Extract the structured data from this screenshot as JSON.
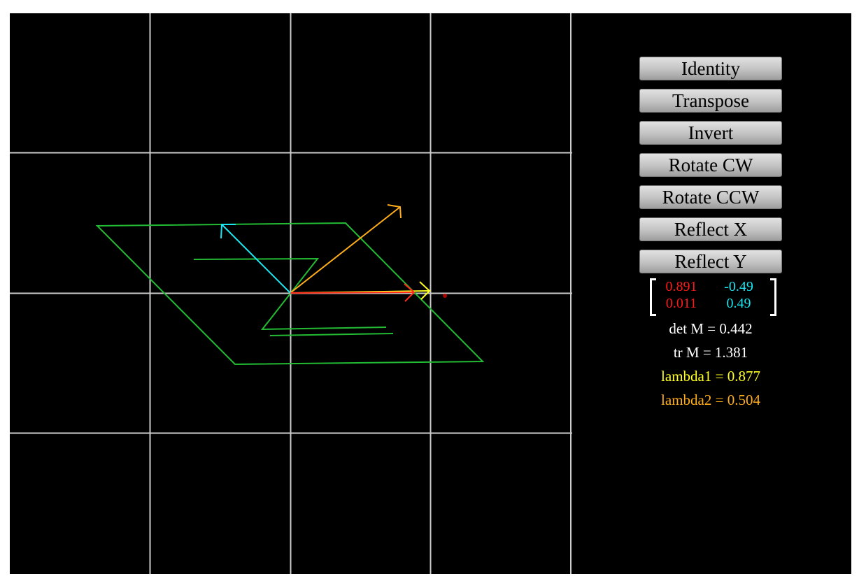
{
  "buttons": {
    "identity": "Identity",
    "transpose": "Transpose",
    "invert": "Invert",
    "rotate_cw": "Rotate CW",
    "rotate_ccw": "Rotate CCW",
    "reflect_x": "Reflect X",
    "reflect_y": "Reflect Y"
  },
  "matrix": {
    "m11": "0.891",
    "m12": "-0.49",
    "m21": "0.011",
    "m22": "0.49"
  },
  "stats": {
    "det": "det M = 0.442",
    "trace": "tr M = 1.381",
    "lambda1": "lambda1 = 0.877",
    "lambda2": "lambda2 = 0.504"
  },
  "colors": {
    "background": "#000000",
    "grid": "#cccccc",
    "shape": "#22bb33",
    "basis_x": "#ff1a1a",
    "basis_y": "#19e6f0",
    "eigen1": "#ffff22",
    "eigen2": "#ffae1a"
  },
  "plot": {
    "grid_spacing": 1,
    "matrix_values": [
      [
        0.891,
        -0.49
      ],
      [
        0.011,
        0.49
      ]
    ],
    "shape_outline": [
      [
        -2,
        0.5
      ],
      [
        -1,
        -0.5
      ],
      [
        2,
        -0.5
      ],
      [
        1,
        0.5
      ]
    ],
    "letter_z_lines": [
      [
        [
          -1.3,
          0.25
        ],
        [
          0.2,
          0.25
        ]
      ],
      [
        [
          0.2,
          0.25
        ],
        [
          -0.2,
          -0.25
        ]
      ],
      [
        [
          -0.2,
          -0.25
        ],
        [
          0.7,
          -0.25
        ]
      ],
      [
        [
          -0.15,
          -0.3
        ],
        [
          0.75,
          -0.3
        ]
      ]
    ],
    "eigenvector_1": [
      0.99,
      0.01
    ],
    "eigenvector_2": [
      0.8,
      0.6
    ],
    "marker_point": [
      1.1,
      -0.02
    ]
  }
}
